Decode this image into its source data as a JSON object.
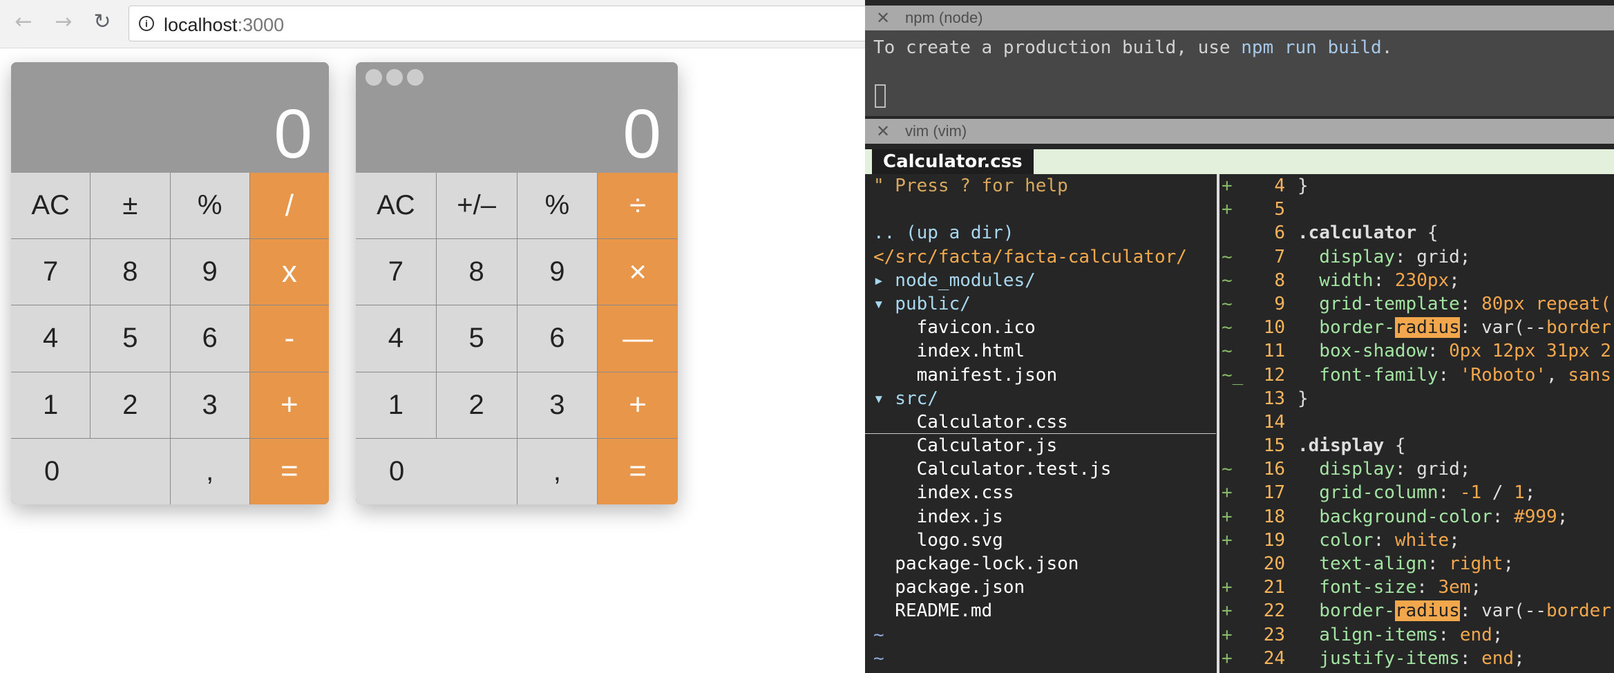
{
  "browser": {
    "back_icon": "arrow-left-icon",
    "forward_icon": "arrow-right-icon",
    "reload_icon": "reload-icon",
    "url_host": "localhost",
    "url_port": ":3000"
  },
  "calculators": [
    {
      "display": "0",
      "keys": [
        "AC",
        "±",
        "%",
        "/",
        "7",
        "8",
        "9",
        "x",
        "4",
        "5",
        "6",
        "-",
        "1",
        "2",
        "3",
        "+",
        "0",
        ",",
        "="
      ]
    },
    {
      "display": "0",
      "keys": [
        "AC",
        "+/–",
        "%",
        "÷",
        "7",
        "8",
        "9",
        "×",
        "4",
        "5",
        "6",
        "—",
        "1",
        "2",
        "3",
        "+",
        "0",
        ",",
        "="
      ]
    }
  ],
  "npm_pane": {
    "title": "npm (node)",
    "line_prefix": "To create a production build, use ",
    "line_cmd": "npm run build",
    "line_suffix": "."
  },
  "vim_pane": {
    "title": "vim (vim)",
    "tab": "Calculator.css",
    "tree": [
      {
        "text": "\" Press ? for help",
        "kind": "help"
      },
      {
        "text": "",
        "kind": "file"
      },
      {
        "text": ".. (up a dir)",
        "kind": "dirline"
      },
      {
        "text": "</src/facta/facta-calculator/",
        "kind": "path"
      },
      {
        "text": "▸ node_modules/",
        "kind": "dirline"
      },
      {
        "text": "▾ public/",
        "kind": "dirline"
      },
      {
        "text": "    favicon.ico",
        "kind": "file"
      },
      {
        "text": "    index.html",
        "kind": "file"
      },
      {
        "text": "    manifest.json",
        "kind": "file"
      },
      {
        "text": "▾ src/",
        "kind": "dirline"
      },
      {
        "text": "    Calculator.css",
        "kind": "sel"
      },
      {
        "text": "    Calculator.js",
        "kind": "file"
      },
      {
        "text": "    Calculator.test.js",
        "kind": "file"
      },
      {
        "text": "    index.css",
        "kind": "file"
      },
      {
        "text": "    index.js",
        "kind": "file"
      },
      {
        "text": "    logo.svg",
        "kind": "file"
      },
      {
        "text": "  package-lock.json",
        "kind": "file"
      },
      {
        "text": "  package.json",
        "kind": "file"
      },
      {
        "text": "  README.md",
        "kind": "file"
      },
      {
        "text": "~",
        "kind": "tilde"
      },
      {
        "text": "~",
        "kind": "tilde"
      }
    ],
    "code": [
      {
        "g": "+",
        "n": "4",
        "parts": [
          [
            "brace",
            "}"
          ]
        ]
      },
      {
        "g": "+",
        "n": "5",
        "parts": []
      },
      {
        "g": "",
        "n": "6",
        "parts": [
          [
            "sel-b",
            ".calculator"
          ],
          [
            "brace",
            " {"
          ]
        ]
      },
      {
        "g": "~",
        "n": "7",
        "parts": [
          [
            "prop",
            "  display"
          ],
          [
            "brace",
            ": grid;"
          ]
        ]
      },
      {
        "g": "~",
        "n": "8",
        "parts": [
          [
            "prop",
            "  width"
          ],
          [
            "brace",
            ": "
          ],
          [
            "val",
            "230px"
          ],
          [
            "brace",
            ";"
          ]
        ]
      },
      {
        "g": "~",
        "n": "9",
        "parts": [
          [
            "prop",
            "  grid"
          ],
          [
            "brace",
            "-"
          ],
          [
            "prop",
            "template"
          ],
          [
            "brace",
            ": "
          ],
          [
            "val",
            "80px repeat("
          ]
        ]
      },
      {
        "g": "~",
        "n": "10",
        "parts": [
          [
            "prop",
            "  border-"
          ],
          [
            "hl",
            "radius"
          ],
          [
            "brace",
            ": var(--"
          ],
          [
            "val",
            "border"
          ]
        ]
      },
      {
        "g": "~",
        "n": "11",
        "parts": [
          [
            "prop",
            "  box-shadow"
          ],
          [
            "brace",
            ": "
          ],
          [
            "val",
            "0px 12px 31px 2"
          ]
        ]
      },
      {
        "g": "~_",
        "n": "12",
        "parts": [
          [
            "prop",
            "  font-family"
          ],
          [
            "brace",
            ": "
          ],
          [
            "val",
            "'Roboto'"
          ],
          [
            "brace",
            ", "
          ],
          [
            "val",
            "sans"
          ]
        ]
      },
      {
        "g": "",
        "n": "13",
        "parts": [
          [
            "brace",
            "}"
          ]
        ]
      },
      {
        "g": "",
        "n": "14",
        "parts": []
      },
      {
        "g": "",
        "n": "15",
        "parts": [
          [
            "sel-b",
            ".display"
          ],
          [
            "brace",
            " {"
          ]
        ]
      },
      {
        "g": "~",
        "n": "16",
        "parts": [
          [
            "prop",
            "  display"
          ],
          [
            "brace",
            ": grid;"
          ]
        ]
      },
      {
        "g": "+",
        "n": "17",
        "parts": [
          [
            "prop",
            "  grid-column"
          ],
          [
            "brace",
            ": "
          ],
          [
            "val",
            "-1"
          ],
          [
            "brace",
            " / "
          ],
          [
            "val",
            "1"
          ],
          [
            "brace",
            ";"
          ]
        ]
      },
      {
        "g": "+",
        "n": "18",
        "parts": [
          [
            "prop",
            "  background-color"
          ],
          [
            "brace",
            ": "
          ],
          [
            "val",
            "#999"
          ],
          [
            "brace",
            ";"
          ]
        ]
      },
      {
        "g": "+",
        "n": "19",
        "parts": [
          [
            "prop",
            "  color"
          ],
          [
            "brace",
            ": "
          ],
          [
            "val",
            "white"
          ],
          [
            "brace",
            ";"
          ]
        ]
      },
      {
        "g": "",
        "n": "20",
        "parts": [
          [
            "prop",
            "  text-align"
          ],
          [
            "brace",
            ": "
          ],
          [
            "val",
            "right"
          ],
          [
            "brace",
            ";"
          ]
        ]
      },
      {
        "g": "+",
        "n": "21",
        "parts": [
          [
            "prop",
            "  font-size"
          ],
          [
            "brace",
            ": "
          ],
          [
            "val",
            "3em"
          ],
          [
            "brace",
            ";"
          ]
        ]
      },
      {
        "g": "+",
        "n": "22",
        "parts": [
          [
            "prop",
            "  border-"
          ],
          [
            "hl",
            "radius"
          ],
          [
            "brace",
            ": var(--"
          ],
          [
            "val",
            "border"
          ]
        ]
      },
      {
        "g": "+",
        "n": "23",
        "parts": [
          [
            "prop",
            "  align-items"
          ],
          [
            "brace",
            ": "
          ],
          [
            "val",
            "end"
          ],
          [
            "brace",
            ";"
          ]
        ]
      },
      {
        "g": "+",
        "n": "24",
        "parts": [
          [
            "prop",
            "  justify-items"
          ],
          [
            "brace",
            ": "
          ],
          [
            "val",
            "end"
          ],
          [
            "brace",
            ";"
          ]
        ]
      }
    ]
  },
  "colors": {
    "accent_orange": "#e8974a",
    "key_grey": "#d9d9d9",
    "display_grey": "#999999"
  }
}
